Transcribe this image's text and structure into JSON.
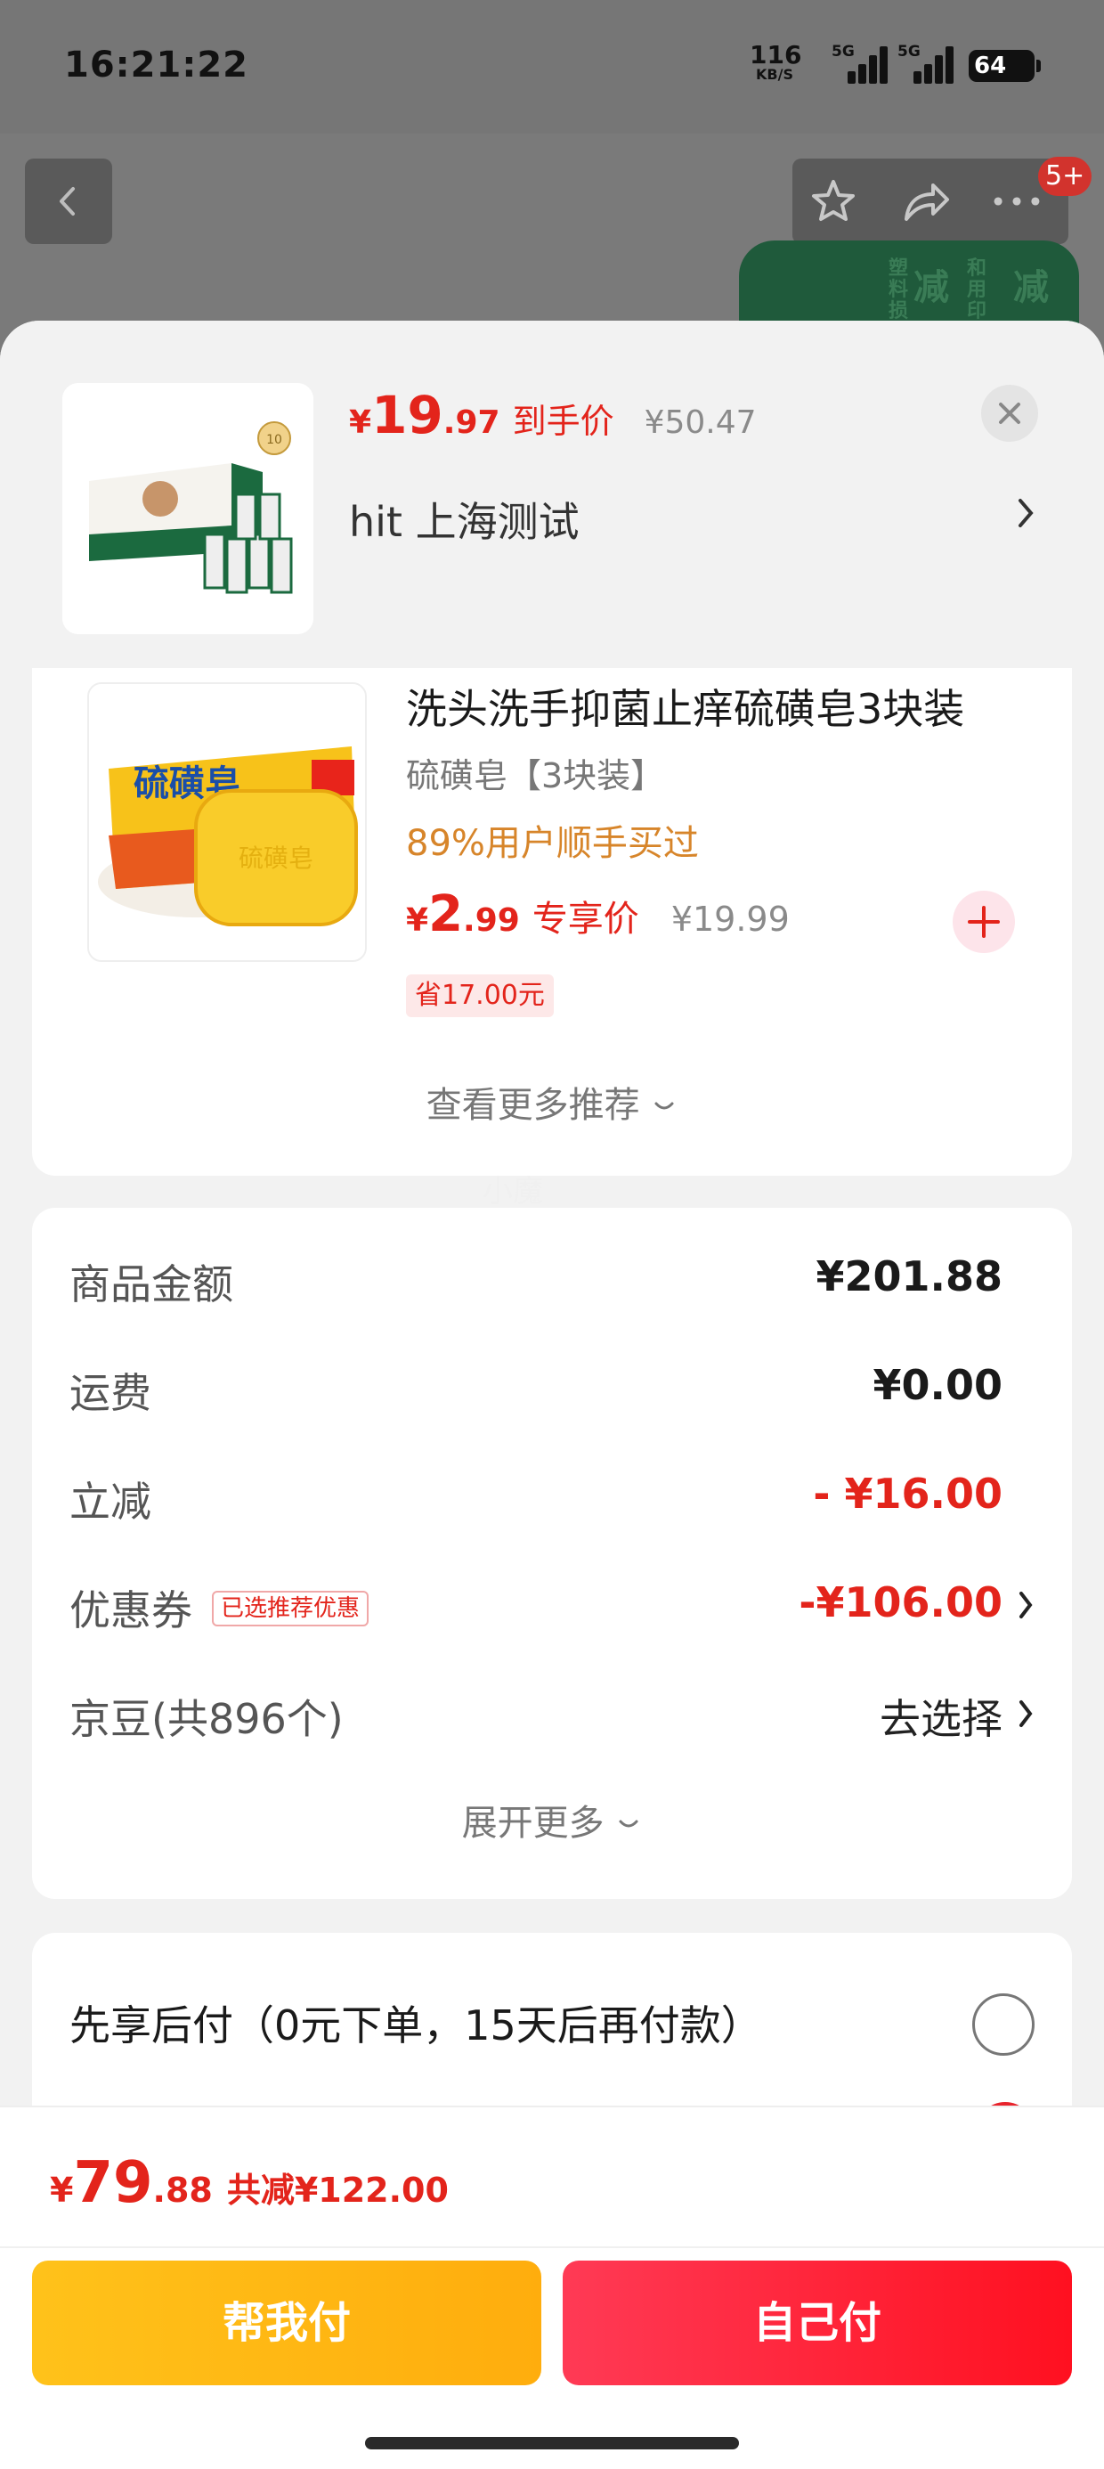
{
  "status_bar": {
    "time": "16:21:22",
    "net_speed_value": "116",
    "net_speed_unit": "KB/S",
    "sim1_label": "5G",
    "sim2_label": "5G",
    "battery": "64"
  },
  "header": {
    "badge_count": "5+",
    "banner_text_1": "减",
    "banner_text_2": "减小",
    "banner_small_1": "塑料损",
    "banner_small_2": "和用印纸刷量"
  },
  "product": {
    "price_yen": "¥",
    "price_int": "19",
    "price_dec": ".97",
    "price_tag": "到手价",
    "original_price": "¥50.47",
    "variant": "hit  上海测试",
    "badge_10": "10"
  },
  "recommendation": {
    "title": "洗头洗手抑菌止痒硫磺皂3块装",
    "spec": "硫磺皂【3块装】",
    "buyers": "89%用户顺手买过",
    "price_yen": "¥",
    "price_int": "2",
    "price_dec": ".99",
    "price_tag": "专享价",
    "original_price": "¥19.99",
    "save": "省17.00元",
    "soap_label": "硫磺皂",
    "see_more": "查看更多推荐"
  },
  "watermark": "小魔",
  "amounts": {
    "goods_label": "商品金额",
    "goods_value": "¥201.88",
    "shipping_label": "运费",
    "shipping_value": "¥0.00",
    "instant_label": "立减",
    "instant_value": "- ¥16.00",
    "coupon_label": "优惠券",
    "coupon_tag": "已选推荐优惠",
    "coupon_value": "-¥106.00",
    "jingdou_label": "京豆(共896个)",
    "jingdou_value": "去选择",
    "expand": "展开更多"
  },
  "pay_later": {
    "text": "先享后付（0元下单，15天后再付款）"
  },
  "bottom": {
    "total_yen": "¥",
    "total_int": "79",
    "total_dec": ".88",
    "saved": "共减¥122.00",
    "help_pay": "帮我付",
    "self_pay": "自己付"
  },
  "colors": {
    "accent_red": "#e3241b",
    "help_button": "#ffb812",
    "self_button": "#ff2036",
    "buyers_orange": "#d7852a"
  }
}
